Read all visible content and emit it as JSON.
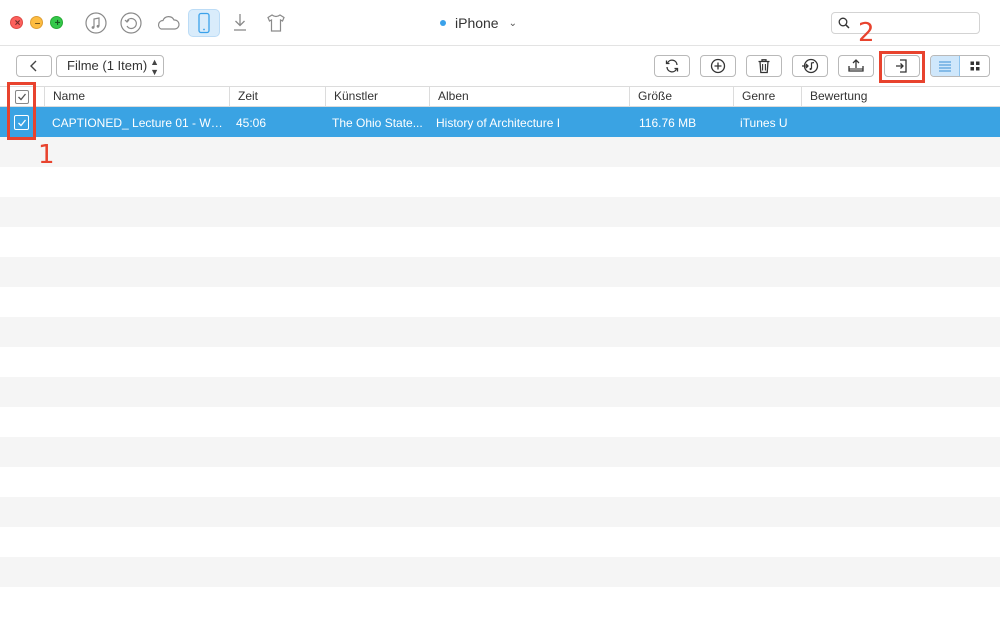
{
  "titlebar": {
    "device_name": "iPhone",
    "search": {
      "placeholder": "",
      "value": ""
    },
    "icons": [
      "music-icon",
      "restore-icon",
      "cloud-icon",
      "phone-icon",
      "download-icon",
      "shirt-icon"
    ],
    "active_icon": "phone-icon"
  },
  "toolbar": {
    "filter_label": "Filme (1 Item)",
    "actions": [
      "refresh-icon",
      "add-icon",
      "trash-icon",
      "to-itunes-icon",
      "export-to-device-icon",
      "export-to-computer-icon"
    ],
    "view_modes": [
      "list-view-icon",
      "grid-view-icon"
    ],
    "active_view": "list-view-icon"
  },
  "table": {
    "columns": [
      "Name",
      "Zeit",
      "Künstler",
      "Alben",
      "Größe",
      "Genre",
      "Bewertung"
    ],
    "rows": [
      {
        "selected": true,
        "name": "CAPTIONED_ Lecture 01 - Wh...",
        "time": "45:06",
        "artist": "The Ohio State...",
        "album": "History of Architecture I",
        "size": "116.76 MB",
        "genre": "iTunes U",
        "rating": ""
      }
    ]
  },
  "annotations": {
    "step1": "1",
    "step2": "2"
  },
  "colors": {
    "accent": "#3aa3e3",
    "callout": "#e8432e",
    "stripe": "#f5f5f5",
    "active_icon_bg": "#d9ecfb"
  }
}
